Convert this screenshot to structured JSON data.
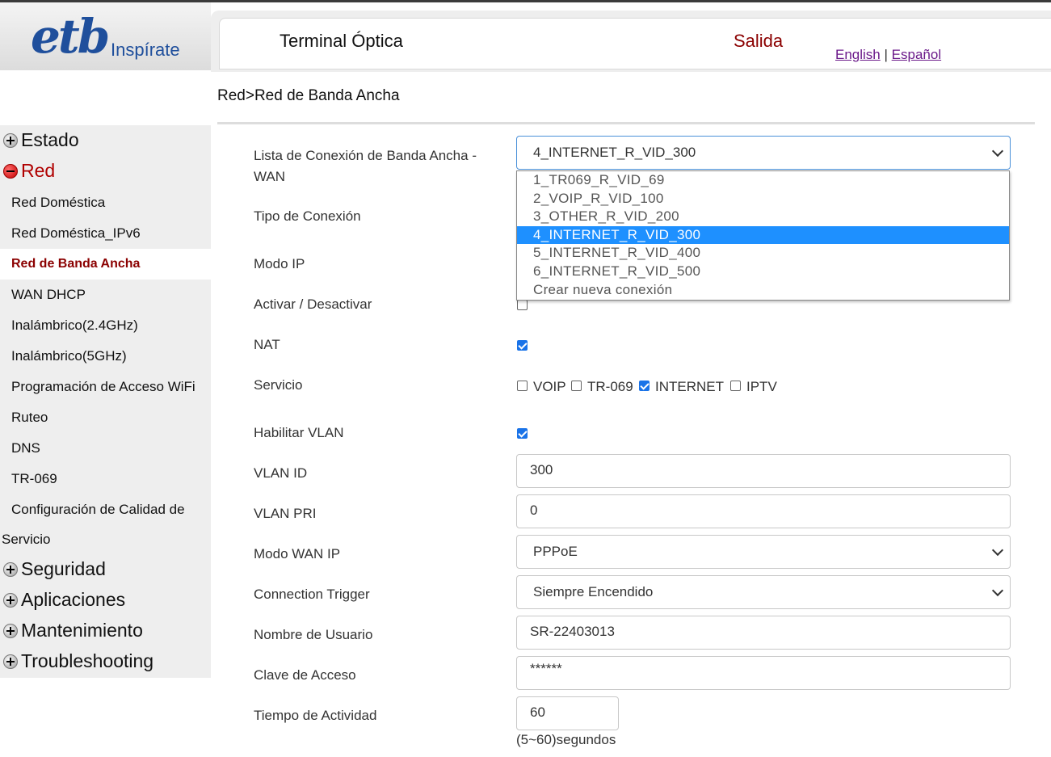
{
  "brand": {
    "logo_text": "etb",
    "tagline": "Inspírate"
  },
  "header": {
    "title": "Terminal Óptica",
    "logout": "Salida",
    "lang_en": "English",
    "lang_sep": "|",
    "lang_es": "Español"
  },
  "breadcrumb": "Red>Red de Banda Ancha",
  "sidebar": {
    "estado": "Estado",
    "red": "Red",
    "red_items": [
      "Red Doméstica",
      "Red Doméstica_IPv6",
      "Red de Banda Ancha",
      "WAN DHCP",
      "Inalámbrico(2.4GHz)",
      "Inalámbrico(5GHz)",
      "Programación de Acceso WiFi",
      "Ruteo",
      "DNS",
      "TR-069",
      "Configuración de Calidad de",
      "Servicio"
    ],
    "seguridad": "Seguridad",
    "aplicaciones": "Aplicaciones",
    "mantenimiento": "Mantenimiento",
    "troubleshooting": "Troubleshooting"
  },
  "form": {
    "lista_label_1": "Lista de Conexión de Banda Ancha -",
    "lista_label_2": "WAN",
    "lista_value": "4_INTERNET_R_VID_300",
    "lista_options": [
      "1_TR069_R_VID_69",
      "2_VOIP_R_VID_100",
      "3_OTHER_R_VID_200",
      "4_INTERNET_R_VID_300",
      "5_INTERNET_R_VID_400",
      "6_INTERNET_R_VID_500",
      "Crear nueva conexión"
    ],
    "tipo_label": "Tipo de Conexión",
    "modo_ip_label": "Modo IP",
    "activar_label": "Activar / Desactivar",
    "activar_checked": false,
    "nat_label": "NAT",
    "nat_checked": true,
    "servicio_label": "Servicio",
    "servicio_voip": "VOIP",
    "servicio_tr069": "TR-069",
    "servicio_internet": "INTERNET",
    "servicio_iptv": "IPTV",
    "vlan_enable_label": "Habilitar VLAN",
    "vlan_enable_checked": true,
    "vlan_id_label": "VLAN ID",
    "vlan_id_value": "300",
    "vlan_pri_label": "VLAN PRI",
    "vlan_pri_value": "0",
    "wan_ip_label": "Modo WAN IP",
    "wan_ip_value": "PPPoE",
    "trigger_label": "Connection Trigger",
    "trigger_value": "Siempre Encendido",
    "user_label": "Nombre de Usuario",
    "user_value": "SR-22403013",
    "pass_label": "Clave de Acceso",
    "pass_value": "******",
    "idle_label": "Tiempo de Actividad",
    "idle_value": "60",
    "idle_hint": "(5~60)segundos"
  },
  "colors": {
    "brand_blue": "#1f4f9c",
    "logout_red": "#8b0000",
    "active_menu": "#8b0000",
    "selected_option": "#1e90ff",
    "checkbox_on": "#1a73e8"
  }
}
